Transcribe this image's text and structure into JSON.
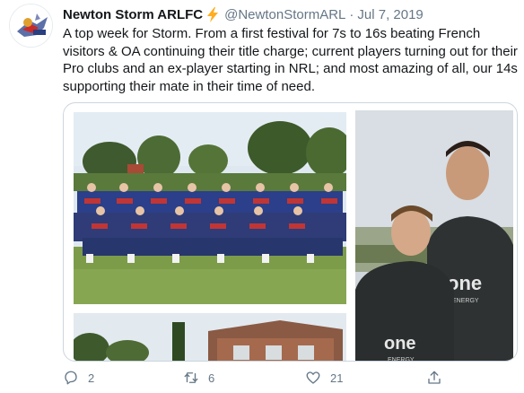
{
  "tweet": {
    "author_name": "Newton Storm ARLFC",
    "handle": "@NewtonStormARL",
    "separator": "·",
    "date": "Jul 7, 2019",
    "text": "A top week for Storm. From a first festival for 7s to 16s beating French visitors & OA continuing their title charge; current players turning out for their Pro clubs and an ex-player starting in NRL; and most amazing of all, our 14s supporting their mate in their time of need."
  },
  "media": {
    "photos": [
      {
        "name": "team-photo",
        "subject": "rugby team group photo on grass"
      },
      {
        "name": "players-photo",
        "subject": "two young players in jerseys",
        "jersey_text": "one",
        "jersey_subtext": "ENERGY"
      },
      {
        "name": "clubhouse-photo",
        "subject": "clubhouse building with trees"
      }
    ]
  },
  "actions": {
    "reply_count": "2",
    "retweet_count": "6",
    "like_count": "21"
  },
  "colors": {
    "text": "#14171a",
    "secondary": "#657786",
    "border": "#ccd6dd",
    "bolt": "#ffad1f"
  },
  "icons": [
    "club-logo-icon",
    "lightning-bolt-icon",
    "reply-icon",
    "retweet-icon",
    "like-icon",
    "share-icon"
  ]
}
